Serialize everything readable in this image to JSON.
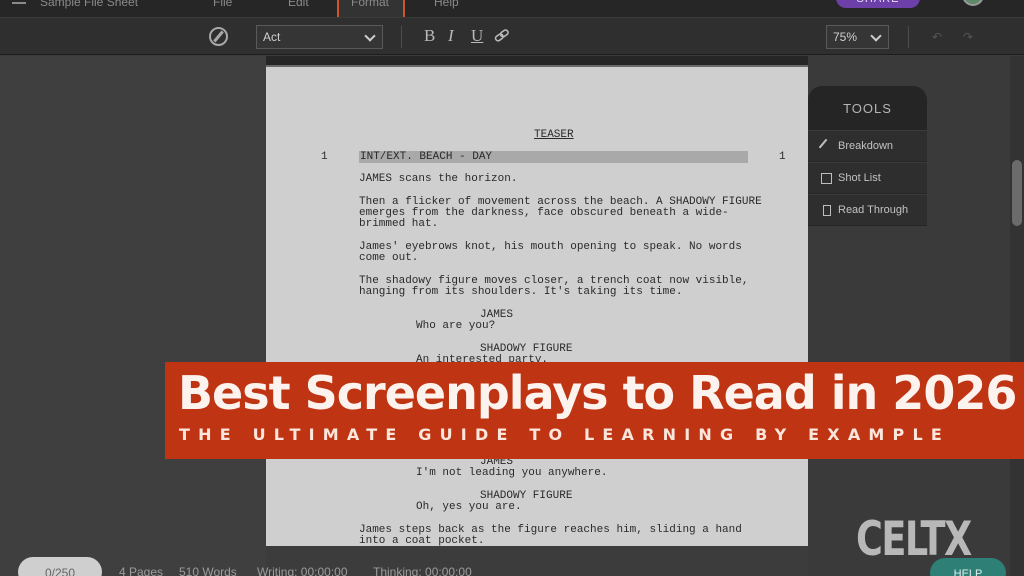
{
  "menu": {
    "doc_title": "Sample File Sheet",
    "items": [
      "File",
      "Edit",
      "Format",
      "Help"
    ],
    "share_label": "SHARE"
  },
  "toolbar": {
    "element_type": "Act",
    "bold": "B",
    "italic": "I",
    "underline": "U",
    "link_icon": "link-icon",
    "zoom": "75%"
  },
  "script": {
    "teaser": "TEASER",
    "scene_number": "1",
    "scene_heading": "INT/EXT. BEACH - DAY",
    "lines": [
      "JAMES scans the horizon.",
      "Then a flicker of movement across the beach. A SHADOWY FIGURE",
      "emerges from the darkness, face obscured beneath a wide-",
      "brimmed hat.",
      "James' eyebrows knot, his mouth opening to speak. No words",
      "come out.",
      "The shadowy figure moves closer, a trench coat now visible,",
      "hanging from its shoulders. It's taking its time."
    ],
    "char1": "JAMES",
    "dial1": "Who are you?",
    "char2": "SHADOWY FIGURE",
    "dial2": "An interested party.",
    "char3": "JAMES",
    "dial3": "I'm not leading you anywhere.",
    "char4": "SHADOWY FIGURE",
    "dial4": "Oh, yes you are.",
    "action_end_1": "James steps back as the figure reaches him, sliding a hand",
    "action_end_2": "into a coat pocket."
  },
  "tools": {
    "title": "TOOLS",
    "items": [
      "Breakdown",
      "Shot List",
      "Read Through"
    ]
  },
  "banner": {
    "title": "Best Screenplays to Read in 2026",
    "subtitle": "THE ULTIMATE GUIDE TO LEARNING BY EXAMPLE"
  },
  "logo": "CELTX",
  "status": {
    "counter": "0/250",
    "pages": "4 Pages",
    "words": "510 Words",
    "writing": "Writing: 00:00:00",
    "thinking": "Thinking: 00:00:00",
    "help": "HELP"
  }
}
